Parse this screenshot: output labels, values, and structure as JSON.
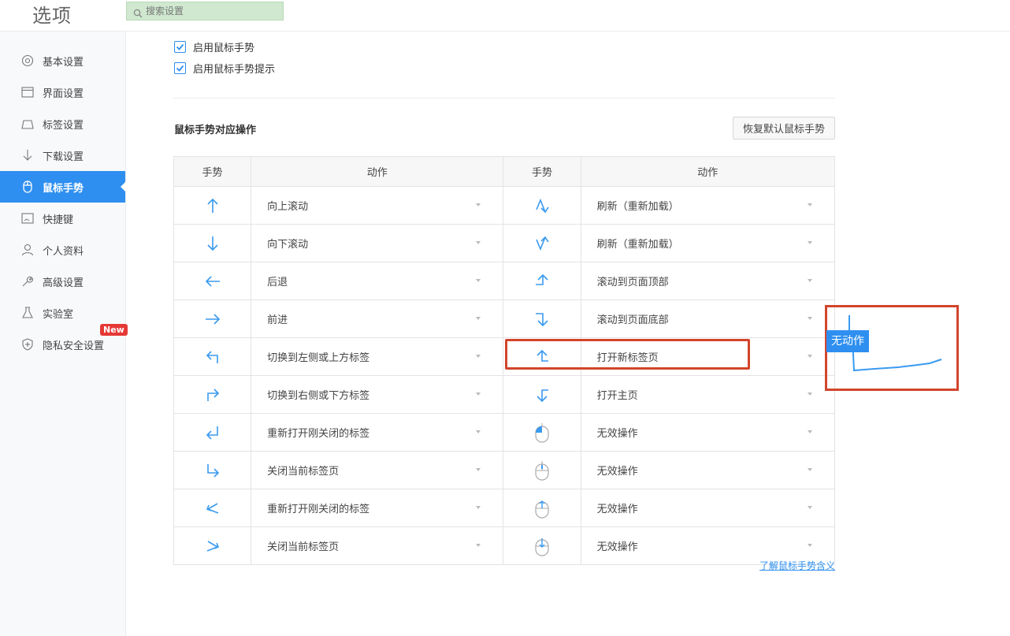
{
  "header": {
    "title": "选项",
    "search_placeholder": "搜索设置"
  },
  "sidebar": {
    "items": [
      {
        "label": "基本设置"
      },
      {
        "label": "界面设置"
      },
      {
        "label": "标签设置"
      },
      {
        "label": "下载设置"
      },
      {
        "label": "鼠标手势"
      },
      {
        "label": "快捷键"
      },
      {
        "label": "个人资料"
      },
      {
        "label": "高级设置"
      },
      {
        "label": "实验室"
      },
      {
        "label": "隐私安全设置",
        "badge": "New"
      }
    ],
    "active_index": 4
  },
  "options": {
    "enable_gestures": "启用鼠标手势",
    "enable_gesture_hints": "启用鼠标手势提示"
  },
  "section": {
    "title": "鼠标手势对应操作",
    "reset_label": "恢复默认鼠标手势"
  },
  "table": {
    "headers": [
      "手势",
      "动作",
      "手势",
      "动作"
    ],
    "rows": [
      {
        "left_gesture": "arrow-up-icon",
        "left_action": "向上滚动",
        "right_gesture": "gesture-up-down-icon",
        "right_action": "刷新（重新加载）"
      },
      {
        "left_gesture": "arrow-down-icon",
        "left_action": "向下滚动",
        "right_gesture": "gesture-down-up-icon",
        "right_action": "刷新（重新加载）"
      },
      {
        "left_gesture": "arrow-left-icon",
        "left_action": "后退",
        "right_gesture": "gesture-right-up-icon",
        "right_action": "滚动到页面顶部"
      },
      {
        "left_gesture": "arrow-right-icon",
        "left_action": "前进",
        "right_gesture": "gesture-right-down-icon",
        "right_action": "滚动到页面底部"
      },
      {
        "left_gesture": "gesture-up-left-icon",
        "left_action": "切换到左侧或上方标签",
        "right_gesture": "gesture-left-up-icon",
        "right_action": "打开新标签页"
      },
      {
        "left_gesture": "gesture-up-right-icon",
        "left_action": "切换到右侧或下方标签",
        "right_gesture": "gesture-left-down-icon",
        "right_action": "打开主页"
      },
      {
        "left_gesture": "gesture-down-left-icon",
        "left_action": "重新打开刚关闭的标签",
        "right_gesture": "mouse-left-button-icon",
        "right_action": "无效操作"
      },
      {
        "left_gesture": "gesture-down-right-icon",
        "left_action": "关闭当前标签页",
        "right_gesture": "mouse-wheel-icon",
        "right_action": "无效操作"
      },
      {
        "left_gesture": "gesture-left-zigzag-icon",
        "left_action": "重新打开刚关闭的标签",
        "right_gesture": "mouse-wheel-up-icon",
        "right_action": "无效操作"
      },
      {
        "left_gesture": "gesture-right-zigzag-icon",
        "left_action": "关闭当前标签页",
        "right_gesture": "mouse-wheel-down-icon",
        "right_action": "无效操作"
      }
    ]
  },
  "help_link": "了解鼠标手势含义",
  "preview": {
    "label": "无动作"
  },
  "colors": {
    "accent": "#2e8ff0",
    "highlight": "#d2452b",
    "badge": "#e53935"
  }
}
